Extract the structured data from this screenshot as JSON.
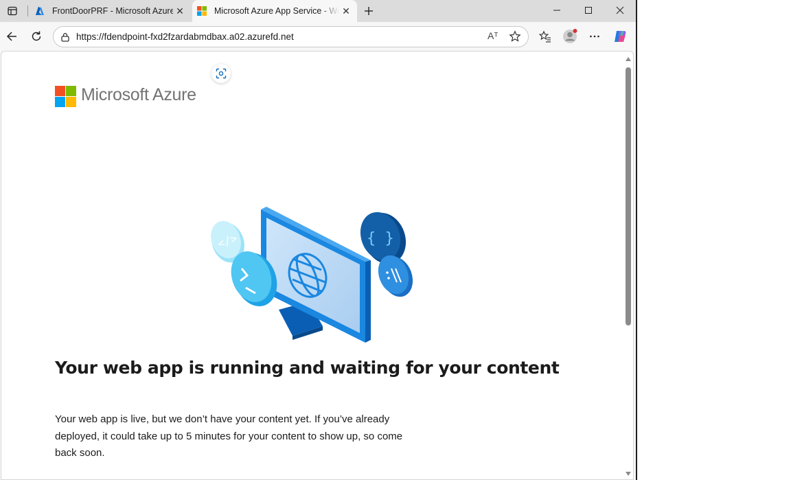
{
  "browser": {
    "tabs": [
      {
        "title": "FrontDoorPRF - Microsoft Azure",
        "active": false,
        "favicon": "azure-icon"
      },
      {
        "title": "Microsoft Azure App Service - We",
        "active": true,
        "favicon": "microsoft-icon"
      }
    ],
    "url": "https://fdendpoint-fxd2fzardabmdbax.a02.azurefd.net",
    "read_aloud_glyph": "Aᵀ"
  },
  "page": {
    "brand": "Microsoft Azure",
    "headline": "Your web app is running and waiting for your content",
    "body": "Your web app is live, but we don’t have your content yet. If you’ve already deployed, it could take up to 5 minutes for your content to show up, so come back soon."
  },
  "colors": {
    "ms_red": "#f25022",
    "ms_green": "#7fba00",
    "ms_blue": "#00a4ef",
    "ms_yellow": "#ffb900",
    "azure_blue": "#0078d4"
  }
}
